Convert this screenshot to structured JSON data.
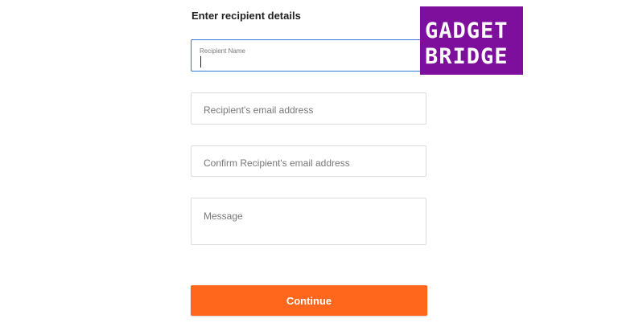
{
  "form": {
    "title": "Enter recipient details",
    "recipient_name_label": "Recipient Name",
    "recipient_name_value": "",
    "email_placeholder": "Recipient's email address",
    "confirm_email_placeholder": "Confirm Recipient's email address",
    "message_placeholder": "Message",
    "continue_label": "Continue"
  },
  "logo": {
    "line1": "GADGET",
    "line2": "BRIDGE"
  },
  "colors": {
    "accent": "#ff671d",
    "focus_border": "#2f7bd6",
    "logo_bg": "#7e0f9c"
  }
}
